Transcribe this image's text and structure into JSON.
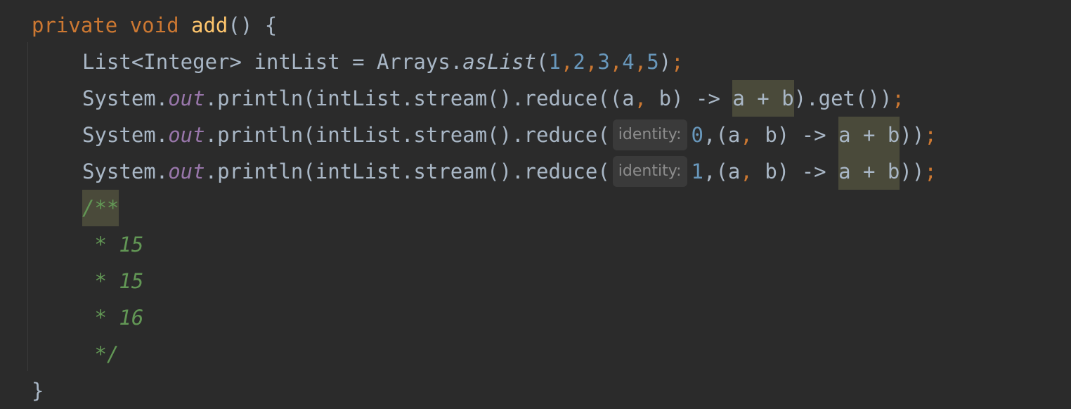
{
  "code": {
    "line1": {
      "private": "private",
      "void": "void",
      "method": "add",
      "rest": "() {"
    },
    "line2": {
      "decl": "List<Integer> intList = Arrays.",
      "asList": "asList",
      "open": "(",
      "args": [
        "1",
        "2",
        "3",
        "4",
        "5"
      ],
      "close": ")",
      "semi": ";"
    },
    "line3": {
      "system": "System.",
      "out": "out",
      "call": ".println(intList.stream().reduce((a",
      "comma": ",",
      "mid": " b) -> ",
      "hl": "a + b",
      "tail": ").get())",
      "semi": ";"
    },
    "line4": {
      "system": "System.",
      "out": "out",
      "call": ".println(intList.stream().reduce(",
      "hint": "identity:",
      "num": "0",
      "mid": ",(a",
      "comma": ",",
      "mid2": " b) -> ",
      "hl": "a + b",
      "tail": "))",
      "semi": ";"
    },
    "line5": {
      "system": "System.",
      "out": "out",
      "call": ".println(intList.stream().reduce(",
      "hint": "identity:",
      "num": "1",
      "mid": ",(a",
      "comma": ",",
      "mid2": " b) -> ",
      "hl": "a + b",
      "tail": "))",
      "semi": ";"
    },
    "comment_open": "/**",
    "comment_lines": [
      " * 15",
      " * 15",
      " * 16"
    ],
    "comment_close": " */",
    "closing_brace": "}"
  },
  "colors": {
    "background": "#2b2b2b",
    "keyword": "#cc7832",
    "method_name": "#ffc66d",
    "number": "#6897bb",
    "field": "#9876aa",
    "comment": "#629755",
    "text": "#a9b7c6"
  }
}
